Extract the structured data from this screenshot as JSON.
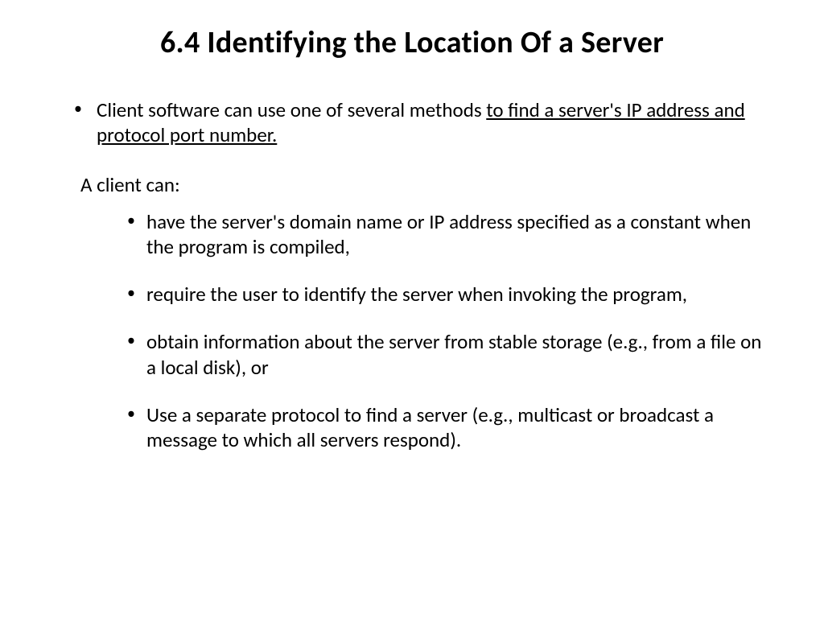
{
  "title": "6.4 Identifying the Location Of a Server",
  "intro": {
    "prefix": "Client software can use one of several methods ",
    "underlined": "to find a server's IP address and protocol port number."
  },
  "subheading": "A client can:",
  "items": [
    "have the server's domain name or IP address specified as a constant when the program is compiled,",
    "require the user to identify the server when invoking the program,",
    "obtain information about the server from stable storage (e.g., from a file on a local disk), or",
    "Use a separate protocol to find a server (e.g., multicast or broadcast a message to which all servers respond)."
  ]
}
